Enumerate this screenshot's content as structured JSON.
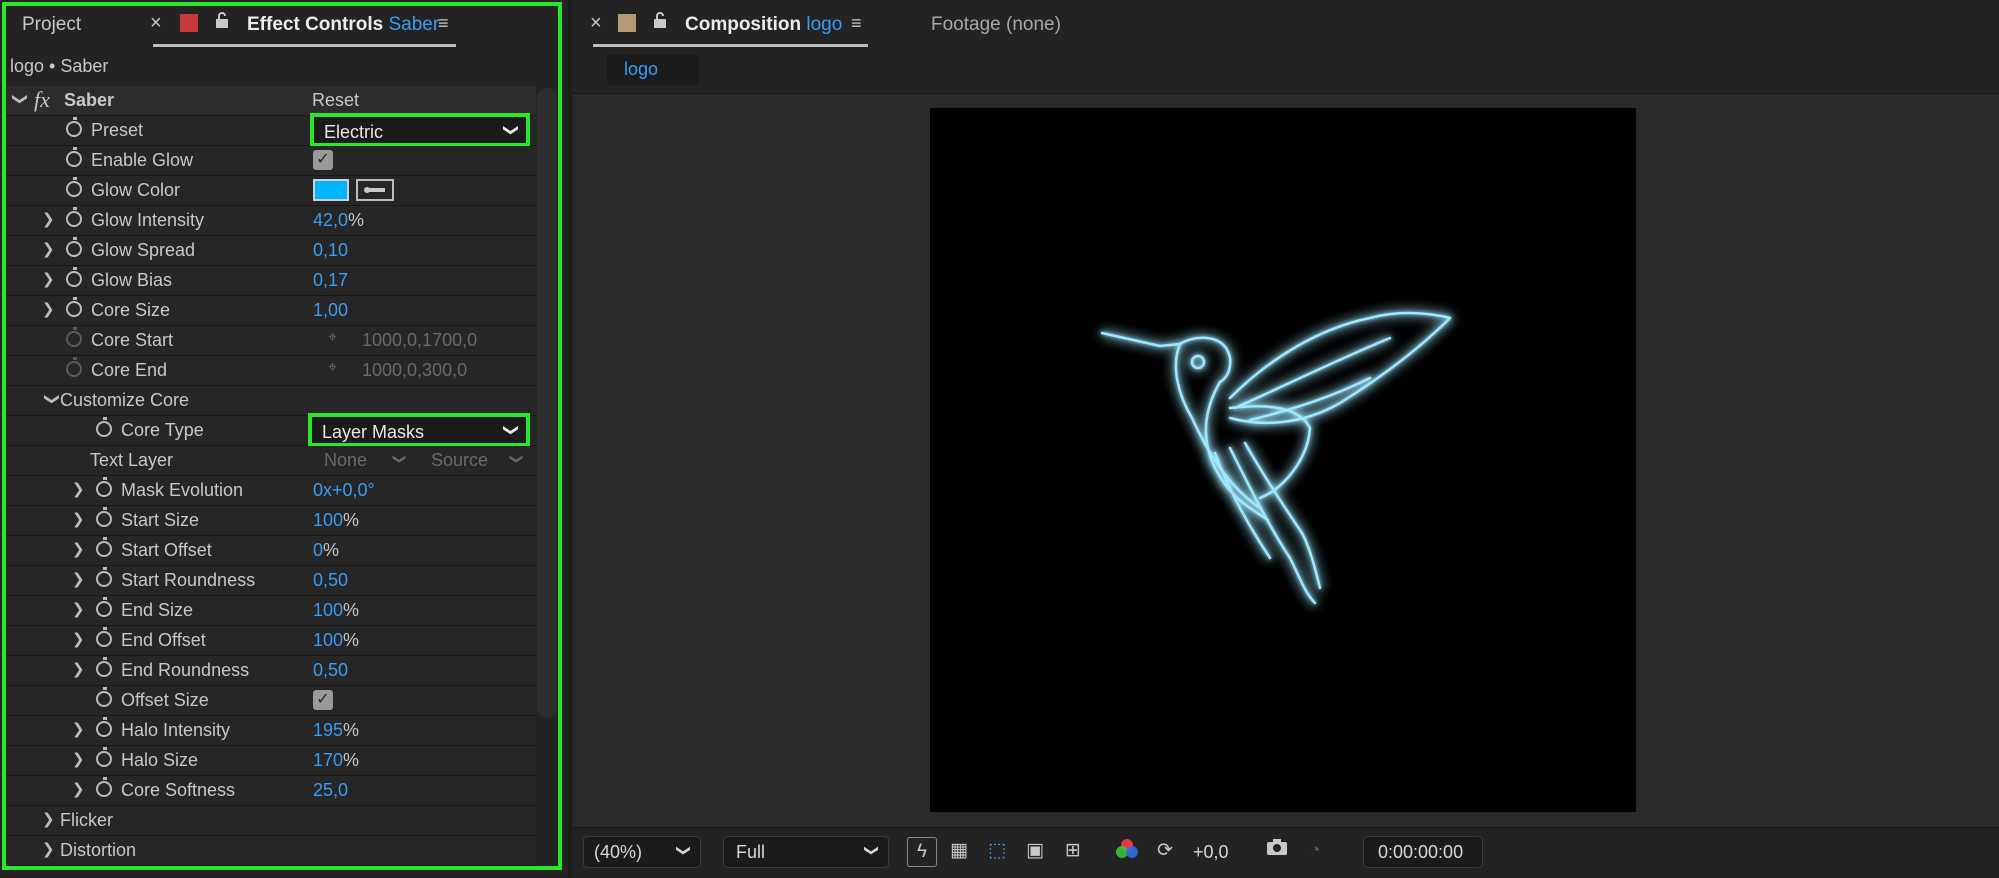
{
  "left_panel": {
    "tabs": {
      "project": "Project",
      "close": "×",
      "effect_controls": "Effect Controls",
      "effect_name": "Saber",
      "menu": "≡"
    },
    "breadcrumb": "logo • Saber",
    "effect": {
      "fx": "fx",
      "name": "Saber",
      "reset": "Reset"
    },
    "properties": [
      {
        "label": "Preset",
        "value": "Electric",
        "kind": "dropdown"
      },
      {
        "label": "Enable Glow",
        "value": "✓",
        "kind": "checkbox"
      },
      {
        "label": "Glow Color",
        "kind": "color",
        "color": "#00b4ff"
      },
      {
        "label": "Glow Intensity",
        "value": "42,0",
        "unit": "%"
      },
      {
        "label": "Glow Spread",
        "value": "0,10"
      },
      {
        "label": "Glow Bias",
        "value": "0,17"
      },
      {
        "label": "Core Size",
        "value": "1,00"
      },
      {
        "label": "Core Start",
        "value": "1000,0,1700,0",
        "dim": true
      },
      {
        "label": "Core End",
        "value": "1000,0,300,0",
        "dim": true
      },
      {
        "label": "Customize Core",
        "kind": "group"
      },
      {
        "label": "Core Type",
        "value": "Layer Masks",
        "kind": "dropdown"
      },
      {
        "label": "Text Layer",
        "value": "None",
        "value2": "Source",
        "dim": true
      },
      {
        "label": "Mask Evolution",
        "value": "0x+0,0°"
      },
      {
        "label": "Start Size",
        "value": "100",
        "unit": "%"
      },
      {
        "label": "Start Offset",
        "value": "0",
        "unit": "%"
      },
      {
        "label": "Start Roundness",
        "value": "0,50"
      },
      {
        "label": "End Size",
        "value": "100",
        "unit": "%"
      },
      {
        "label": "End Offset",
        "value": "100",
        "unit": "%"
      },
      {
        "label": "End Roundness",
        "value": "0,50"
      },
      {
        "label": "Offset Size",
        "value": "✓",
        "kind": "checkbox"
      },
      {
        "label": "Halo Intensity",
        "value": "195",
        "unit": "%"
      },
      {
        "label": "Halo Size",
        "value": "170",
        "unit": "%"
      },
      {
        "label": "Core Softness",
        "value": "25,0"
      },
      {
        "label": "Flicker",
        "kind": "group"
      },
      {
        "label": "Distortion",
        "kind": "group"
      }
    ]
  },
  "right_panel": {
    "tabs": {
      "close": "×",
      "composition": "Composition",
      "comp_name": "logo",
      "menu": "≡",
      "footage": "Footage (none)"
    },
    "sub_tab": "logo",
    "bottom_bar": {
      "zoom": "(40%)",
      "resolution": "Full",
      "exposure": "+0,0",
      "timecode": "0:00:00:00"
    }
  },
  "colors": {
    "accent_blue": "#3b9cf5",
    "highlight_green": "#2ce62c",
    "glow_color": "#00b4ff",
    "project_swatch": "#c63a3a",
    "comp_swatch": "#b59a78"
  }
}
